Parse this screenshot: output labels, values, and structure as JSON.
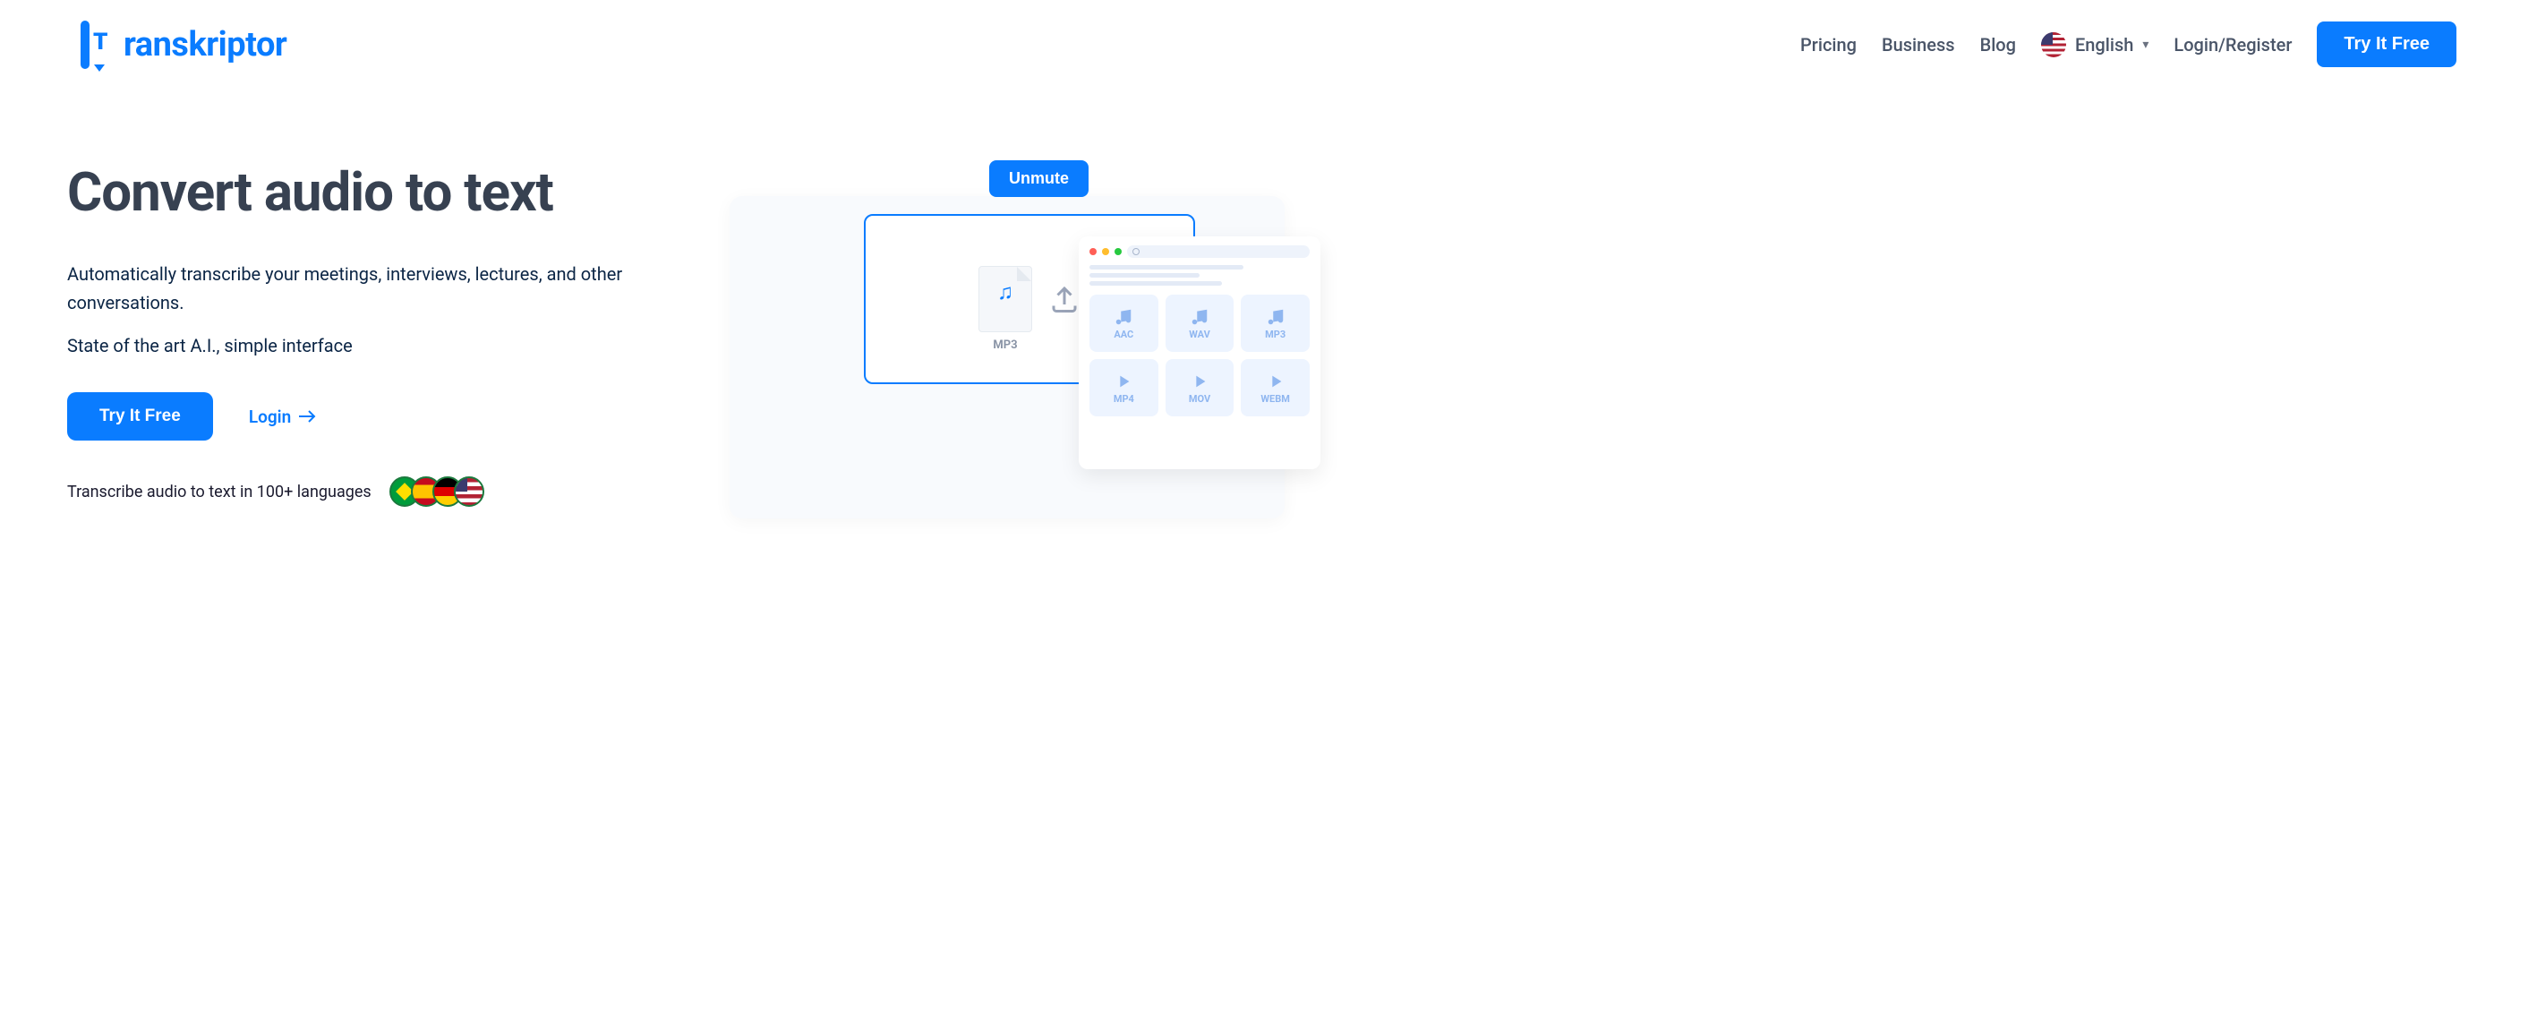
{
  "brand": "ranskriptor",
  "nav": {
    "pricing": "Pricing",
    "business": "Business",
    "blog": "Blog",
    "language": "English",
    "login_register": "Login/Register",
    "cta": "Try It Free"
  },
  "hero": {
    "title": "Convert audio to text",
    "sub1": "Automatically transcribe your meetings, interviews, lectures, and other conversations.",
    "sub2": "State of the art A.I., simple interface",
    "cta": "Try It Free",
    "login": "Login",
    "lang_note": "Transcribe audio to text in 100+ languages"
  },
  "video": {
    "unmute": "Unmute",
    "dropzone_file": "MP3",
    "formats": [
      "AAC",
      "WAV",
      "MP3",
      "MP4",
      "MOV",
      "WEBM"
    ]
  }
}
